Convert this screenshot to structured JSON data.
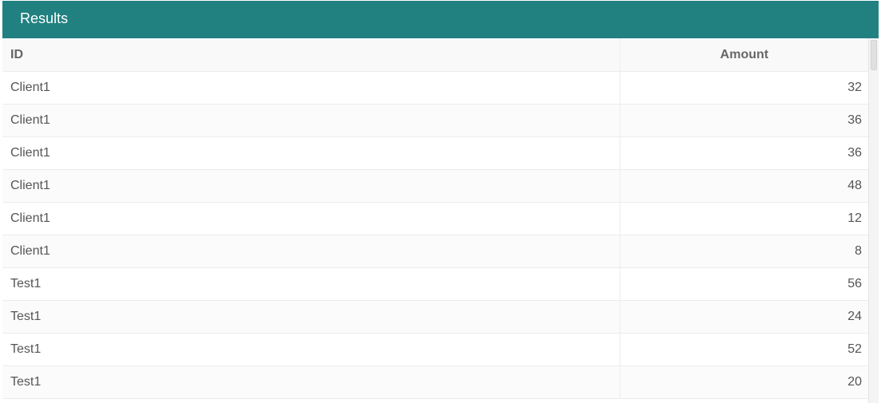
{
  "panel": {
    "title": "Results",
    "header_color": "#218180"
  },
  "grid": {
    "columns": [
      {
        "key": "id",
        "label": "ID"
      },
      {
        "key": "amount",
        "label": "Amount"
      }
    ],
    "rows": [
      {
        "id": "Client1",
        "amount": "32"
      },
      {
        "id": "Client1",
        "amount": "36"
      },
      {
        "id": "Client1",
        "amount": "36"
      },
      {
        "id": "Client1",
        "amount": "48"
      },
      {
        "id": "Client1",
        "amount": "12"
      },
      {
        "id": "Client1",
        "amount": "8"
      },
      {
        "id": "Test1",
        "amount": "56"
      },
      {
        "id": "Test1",
        "amount": "24"
      },
      {
        "id": "Test1",
        "amount": "52"
      },
      {
        "id": "Test1",
        "amount": "20"
      }
    ]
  }
}
